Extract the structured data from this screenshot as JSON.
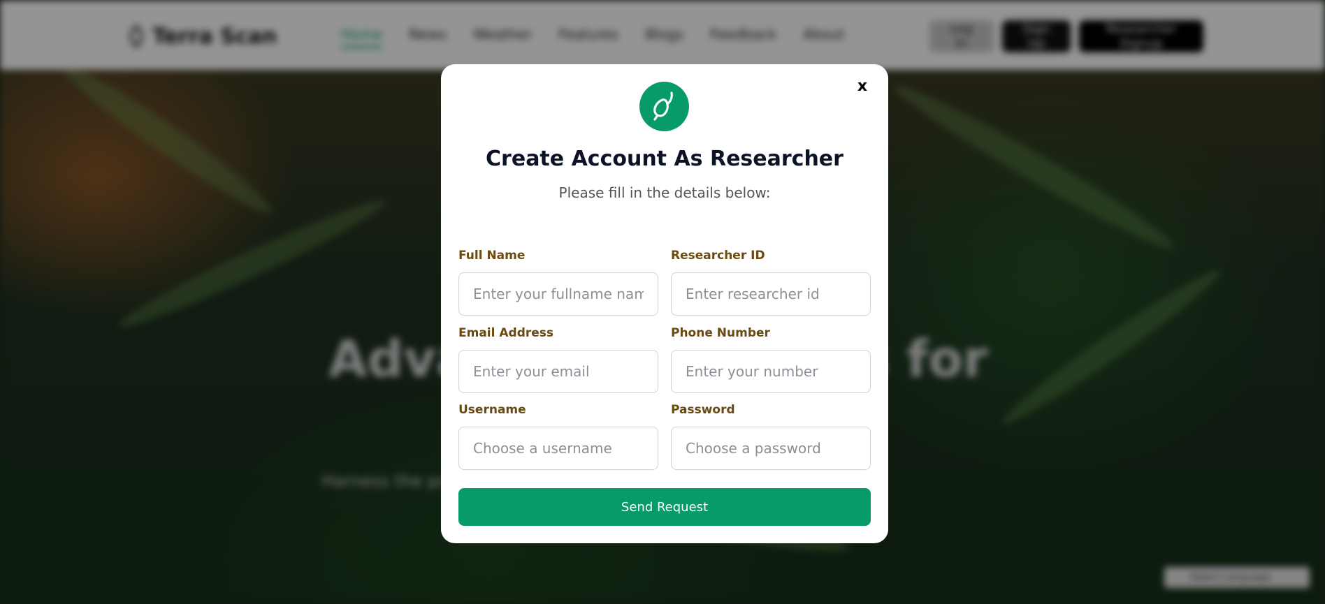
{
  "navbar": {
    "brand": "Terra Scan",
    "links": [
      "Home",
      "News",
      "Weather",
      "Features",
      "Blogs",
      "Feedback",
      "About"
    ],
    "login_label": "Log In",
    "signup_label": "Sign Up",
    "researcher_signup_label": "Researcher Signup"
  },
  "hero": {
    "title": "Advanced Solutions for",
    "subtitle": "Harness the power of technology for agricultural innovation and"
  },
  "language_widget": {
    "label": "Select Language"
  },
  "modal": {
    "close_label": "x",
    "title": "Create Account As Researcher",
    "subtitle": "Please fill in the details below:",
    "fields": {
      "full_name": {
        "label": "Full Name",
        "placeholder": "Enter your fullname name"
      },
      "researcher_id": {
        "label": "Researcher ID",
        "placeholder": "Enter researcher id"
      },
      "email": {
        "label": "Email Address",
        "placeholder": "Enter your email"
      },
      "phone": {
        "label": "Phone Number",
        "placeholder": "Enter your number"
      },
      "username": {
        "label": "Username",
        "placeholder": "Choose a username"
      },
      "password": {
        "label": "Password",
        "placeholder": "Choose a password"
      }
    },
    "submit_label": "Send Request"
  },
  "colors": {
    "accent_green": "#079a6b",
    "label_brown": "#6a4a10",
    "title_dark": "#0d1326"
  }
}
